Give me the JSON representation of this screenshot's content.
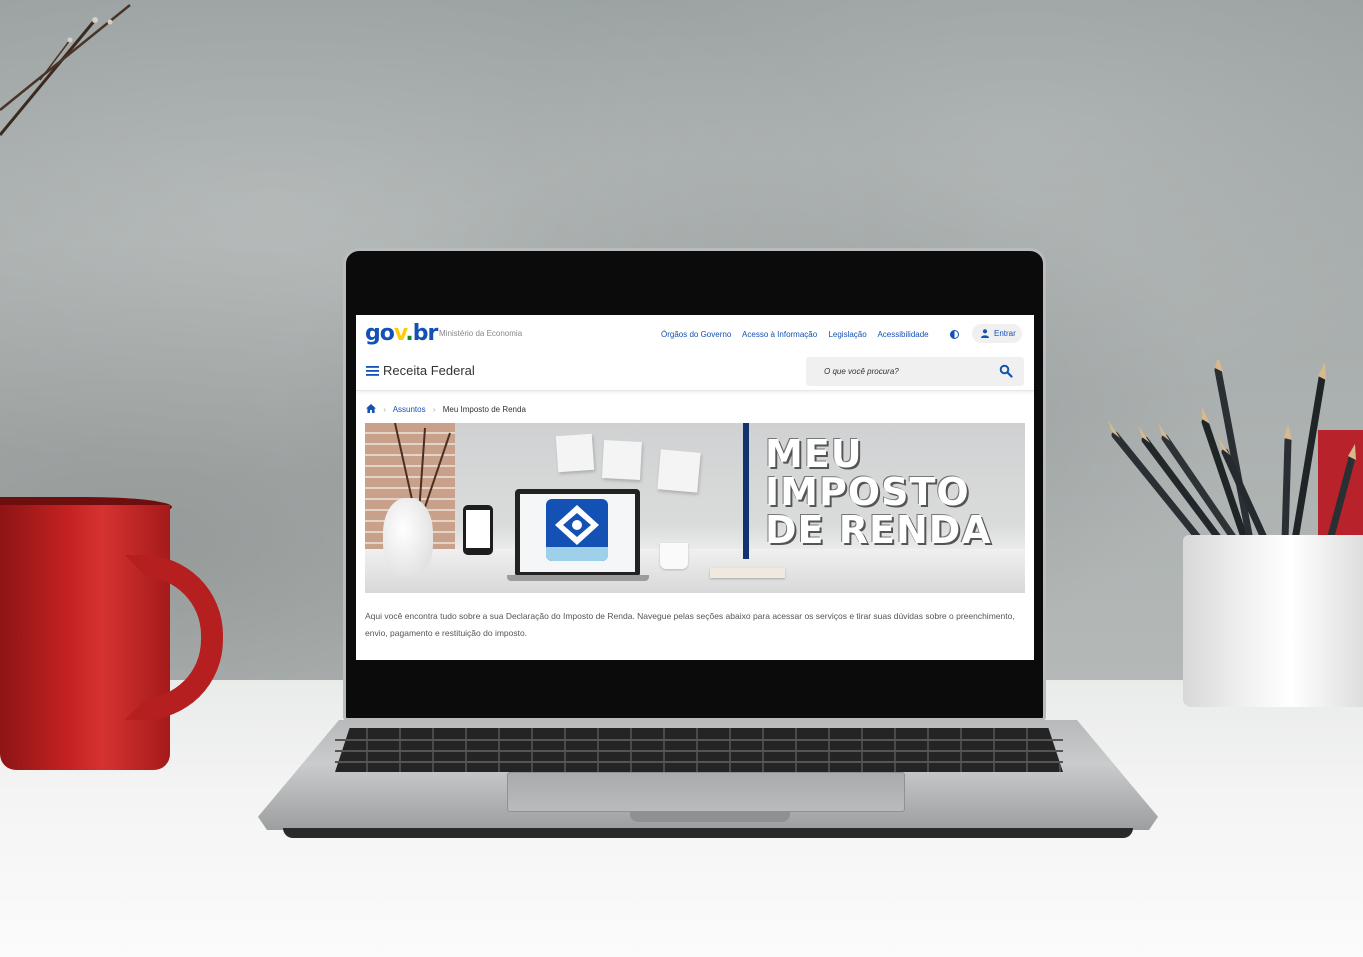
{
  "site": {
    "logo": {
      "part1": "go",
      "part2": "v",
      "part3": ".",
      "part4": "br"
    },
    "ministry": "Ministério da Economia",
    "top_links": [
      "Órgãos do Governo",
      "Acesso à Informação",
      "Legislação",
      "Acessibilidade"
    ],
    "login_label": "Entrar",
    "title": "Receita Federal",
    "search_placeholder": "O que você procura?",
    "breadcrumb": {
      "link": "Assuntos",
      "current": "Meu Imposto de Renda"
    },
    "banner_title_lines": [
      "MEU",
      "IMPOSTO",
      "DE RENDA"
    ],
    "intro_text": "Aqui você encontra tudo sobre a sua Declaração do Imposto de Renda. Navegue pelas seções abaixo para acessar os serviços e tirar suas dúvidas sobre o preenchimento, envio, pagamento e restituição do imposto."
  },
  "colors": {
    "gov_blue": "#1351b4",
    "gov_yellow": "#ffcd07",
    "gov_green": "#168821",
    "banner_bar": "#12336e",
    "mug_red": "#c42222"
  },
  "icons": [
    "menu-icon",
    "search-icon",
    "home-icon",
    "user-icon",
    "contrast-icon"
  ]
}
